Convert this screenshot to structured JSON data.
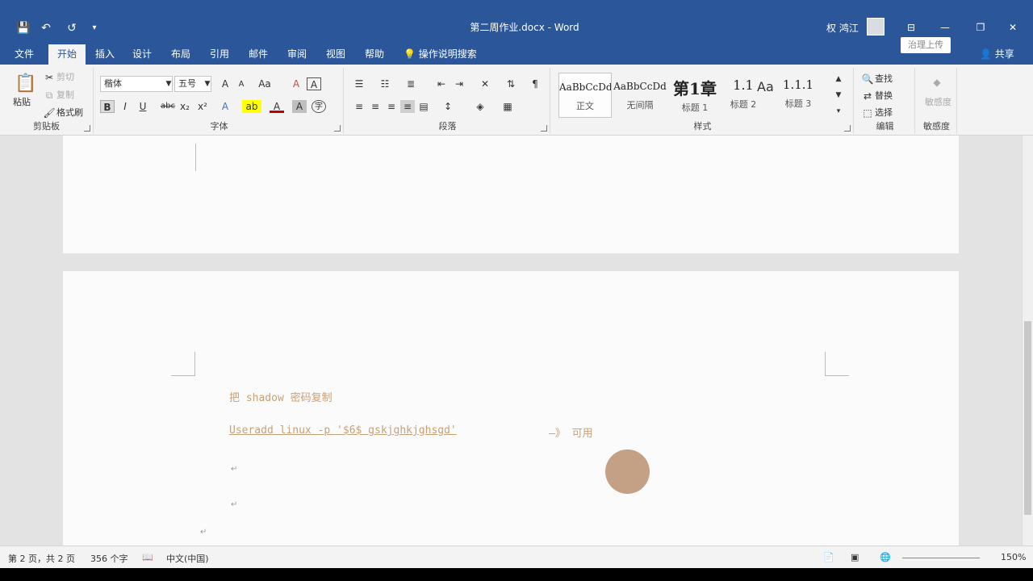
{
  "window": {
    "title": "第二周作业.docx - Word",
    "user": "权 鸿江",
    "controls": {
      "ribbon_display": "⊟",
      "minimize": "—",
      "restore": "❐",
      "close": "✕"
    }
  },
  "quick_access": {
    "save": "💾",
    "undo": "↶",
    "redo": "↺",
    "customize": "▾"
  },
  "tabs": [
    {
      "label": "文件"
    },
    {
      "label": "开始"
    },
    {
      "label": "插入"
    },
    {
      "label": "设计"
    },
    {
      "label": "布局"
    },
    {
      "label": "引用"
    },
    {
      "label": "邮件"
    },
    {
      "label": "审阅"
    },
    {
      "label": "视图"
    },
    {
      "label": "帮助"
    }
  ],
  "tell_me": "操作说明搜索",
  "share": "共享",
  "sensitivity_upload": "治理上传",
  "ribbon": {
    "clipboard": {
      "label": "剪贴板",
      "paste": "粘贴",
      "cut": "剪切",
      "copy": "复制",
      "format_painter": "格式刷"
    },
    "font": {
      "label": "字体",
      "font_name": "楷体",
      "font_size": "五号",
      "grow": "A",
      "shrink": "A",
      "case": "Aa",
      "clear": "A",
      "char_border": "A",
      "bold": "B",
      "italic": "I",
      "underline": "U",
      "strike": "abc",
      "subscript": "x₂",
      "superscript": "x²",
      "effects": "A",
      "highlight": "ab",
      "font_color": "A",
      "char_shading": "A",
      "enclose": "字"
    },
    "paragraph": {
      "label": "段落"
    },
    "styles": {
      "label": "样式",
      "items": [
        {
          "sample": "AaBbCcDd",
          "name": "正文"
        },
        {
          "sample": "AaBbCcDd",
          "name": "无间隔"
        },
        {
          "sample": "第1章",
          "name": "标题 1"
        },
        {
          "sample": "1.1",
          "name": "标题 2"
        },
        {
          "sample": "1.1.1",
          "name": "标题 3"
        }
      ],
      "extra_sample": "Aa"
    },
    "editing": {
      "label": "编辑",
      "find": "查找",
      "replace": "替换",
      "select": "选择"
    },
    "sensitivity": {
      "label": "敏感度",
      "item": "敏感度"
    }
  },
  "document": {
    "line1": "把 shadow 密码复制",
    "line2_cmd": "Useradd linux -p '$6$ gskjghkjghsgd'",
    "line2_arrow": "—》 可用",
    "para_mark": "↵"
  },
  "status": {
    "page": "第 2 页，共 2 页",
    "words": "356 个字",
    "language": "中文(中国)",
    "zoom": "150%"
  }
}
